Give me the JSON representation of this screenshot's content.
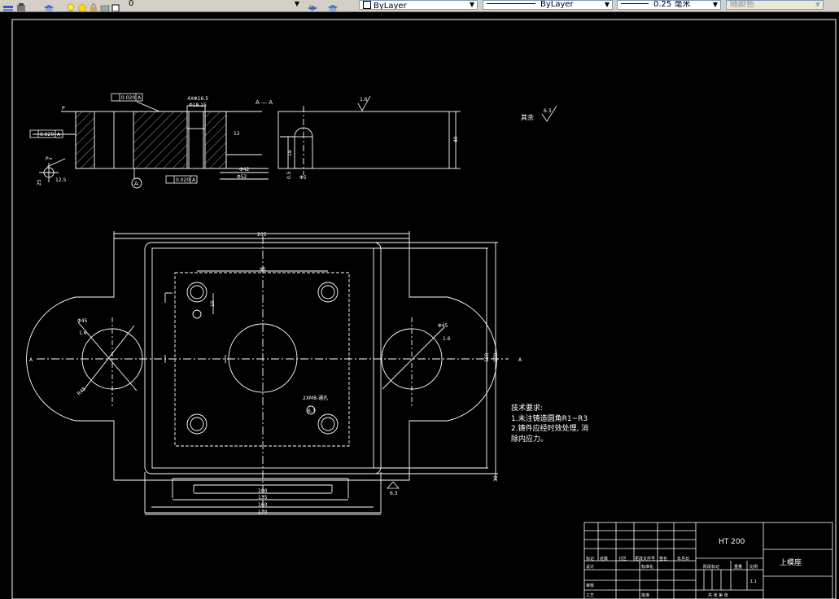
{
  "toolbar": {
    "layer_value": "0",
    "color_value": "ByLayer",
    "linetype_value": "ByLayer",
    "lineweight_value": "0.25 毫米",
    "plotstyle_value": "随颜色",
    "dropdown_glyph": "▼"
  },
  "drawing": {
    "section_label": "A — A",
    "view_marker": "A",
    "ref_mark": "A",
    "p_label": "P",
    "p_sym": "P=",
    "tol_parallel": "0.020",
    "tol_flat": "0.020",
    "tol_flat2": "0.020",
    "slot_spec": "4XΦ16.5",
    "slot_spec2": "Φ18.15",
    "rough_top": "1.6",
    "rough_other": "6.3",
    "rough_other_prefix": "其余",
    "dim_40": "40",
    "dim_12": "12",
    "dim_18": "18",
    "dim_05": "0.5",
    "dim_phi42": "Φ42",
    "dim_phi52": "Φ52",
    "dim_phi5": "Φ5",
    "dim_125": "12.5",
    "dim_25": "25",
    "dim_205": "205",
    "dim_95": "95",
    "dim_10": "10",
    "dim_170": "170",
    "dim_100": "100",
    "dim_135": "135",
    "dim_160": "160",
    "dim_170b": "170",
    "dim_30": "30",
    "dim_phi45_l": "Φ45",
    "dim_phi45_r": "Φ45",
    "dim_16_l": "1.6",
    "dim_16_r": "1.6",
    "dim_r45": "R45",
    "dim_thread": "2XM8-通孔",
    "dim_thread_depth": "6.3",
    "bottom_rough": "6.3",
    "notes_title": "技术要求:",
    "note1": "1.未注铸造圆角R1~R3",
    "note2": "2.铸件应经时效处理, 消",
    "note2b": "除内应力。"
  },
  "title_block": {
    "material": "HT 200",
    "part_name": "上模座",
    "scale_value": "1:1",
    "h1": "标记",
    "h2": "处数",
    "h3": "分区",
    "h4": "更改文件号",
    "h5": "签名",
    "h6": "年月日",
    "design": "设计",
    "standard": "标准化",
    "stage": "阶段标记",
    "weight": "重量",
    "scale": "比例",
    "review": "审核",
    "process": "工艺",
    "approve": "批准",
    "sheets": "共  张  第  张"
  }
}
